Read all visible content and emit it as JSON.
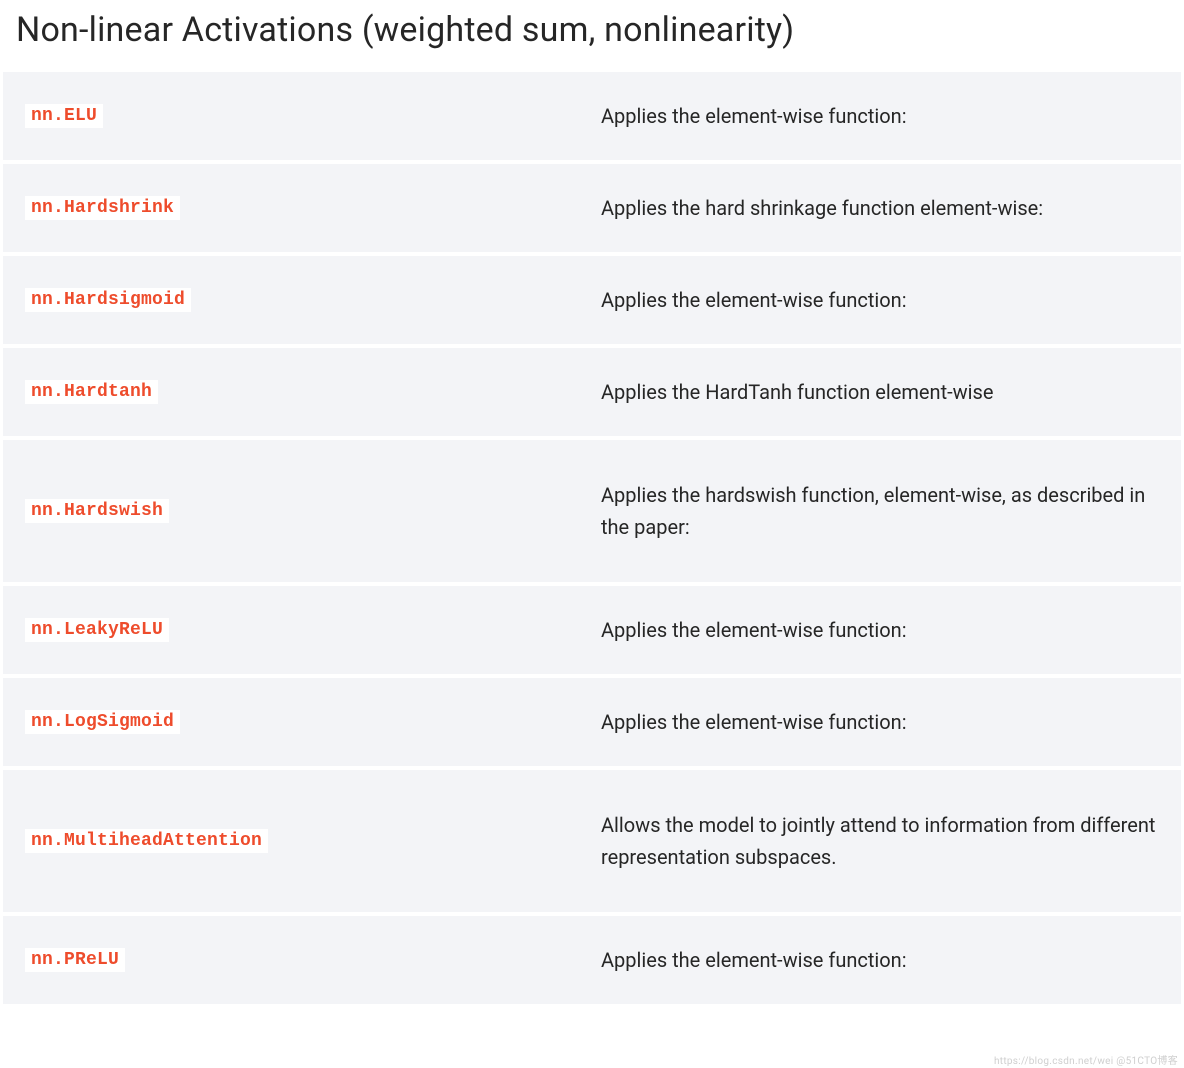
{
  "header": {
    "title": "Non-linear Activations (weighted sum, nonlinearity)"
  },
  "rows": [
    {
      "name": "nn.ELU",
      "desc": "Applies the element-wise function:"
    },
    {
      "name": "nn.Hardshrink",
      "desc": "Applies the hard shrinkage function element-wise:"
    },
    {
      "name": "nn.Hardsigmoid",
      "desc": "Applies the element-wise function:"
    },
    {
      "name": "nn.Hardtanh",
      "desc": "Applies the HardTanh function element-wise"
    },
    {
      "name": "nn.Hardswish",
      "desc": "Applies the hardswish function, element-wise, as described in the paper:"
    },
    {
      "name": "nn.LeakyReLU",
      "desc": "Applies the element-wise function:"
    },
    {
      "name": "nn.LogSigmoid",
      "desc": "Applies the element-wise function:"
    },
    {
      "name": "nn.MultiheadAttention",
      "desc": "Allows the model to jointly attend to information from different representation subspaces."
    },
    {
      "name": "nn.PReLU",
      "desc": "Applies the element-wise function:"
    }
  ],
  "watermark": "https://blog.csdn.net/wei @51CTO博客"
}
